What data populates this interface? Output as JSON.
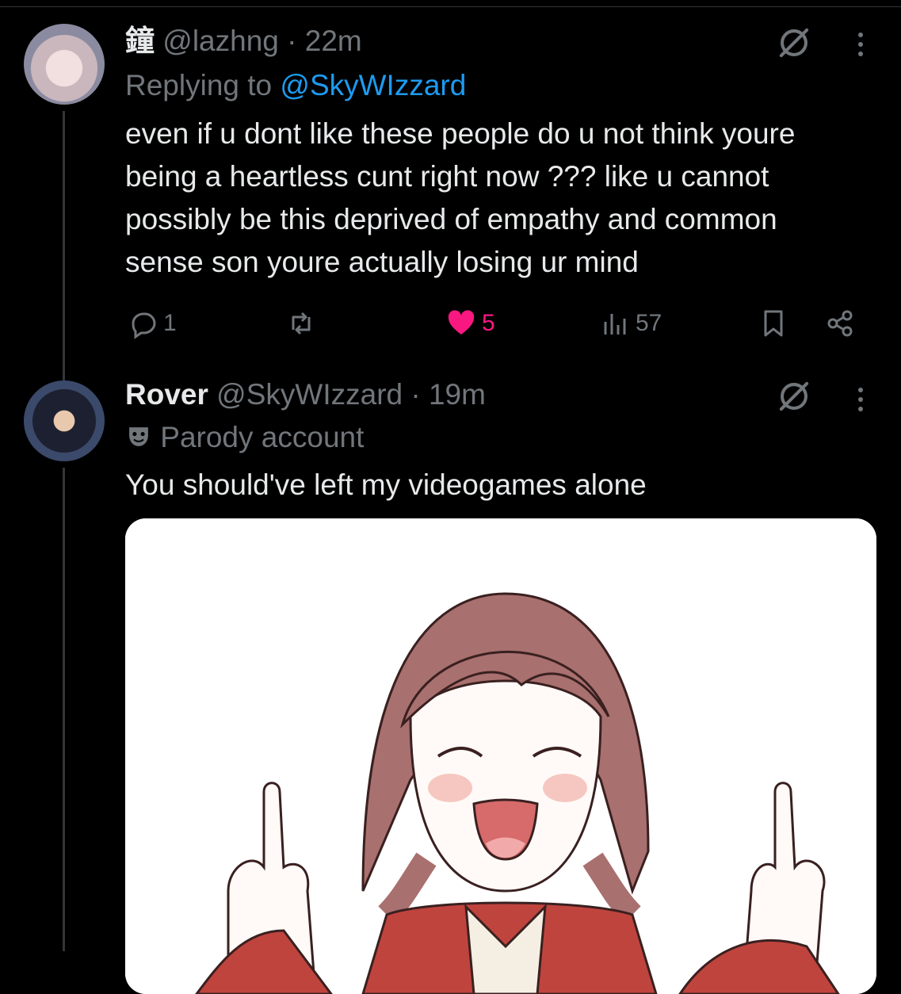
{
  "reply": {
    "display_name": "鐘",
    "handle": "@lazhng",
    "time": "· 22m",
    "replying_prefix": "Replying to",
    "replying_to": "@SkyWIzzard",
    "text": "even if u dont like these people do u not think youre being a heartless cunt right now ??? like u cannot possibly be this deprived of empathy and common sense son youre actually losing ur mind",
    "counts": {
      "replies": "1",
      "reposts": "",
      "likes": "5",
      "views": "57"
    }
  },
  "post": {
    "display_name": "Rover",
    "handle": "@SkyWIzzard",
    "time": "· 19m",
    "badge_label": "Parody account",
    "text": "You should've left my videogames alone"
  },
  "colors": {
    "like": "#f91880",
    "link": "#1d9bf0",
    "muted": "#71767b"
  },
  "icons": [
    "grok-icon",
    "more-icon",
    "reply-icon",
    "repost-icon",
    "heart-icon",
    "views-icon",
    "bookmark-icon",
    "share-icon",
    "parody-mask-icon"
  ]
}
